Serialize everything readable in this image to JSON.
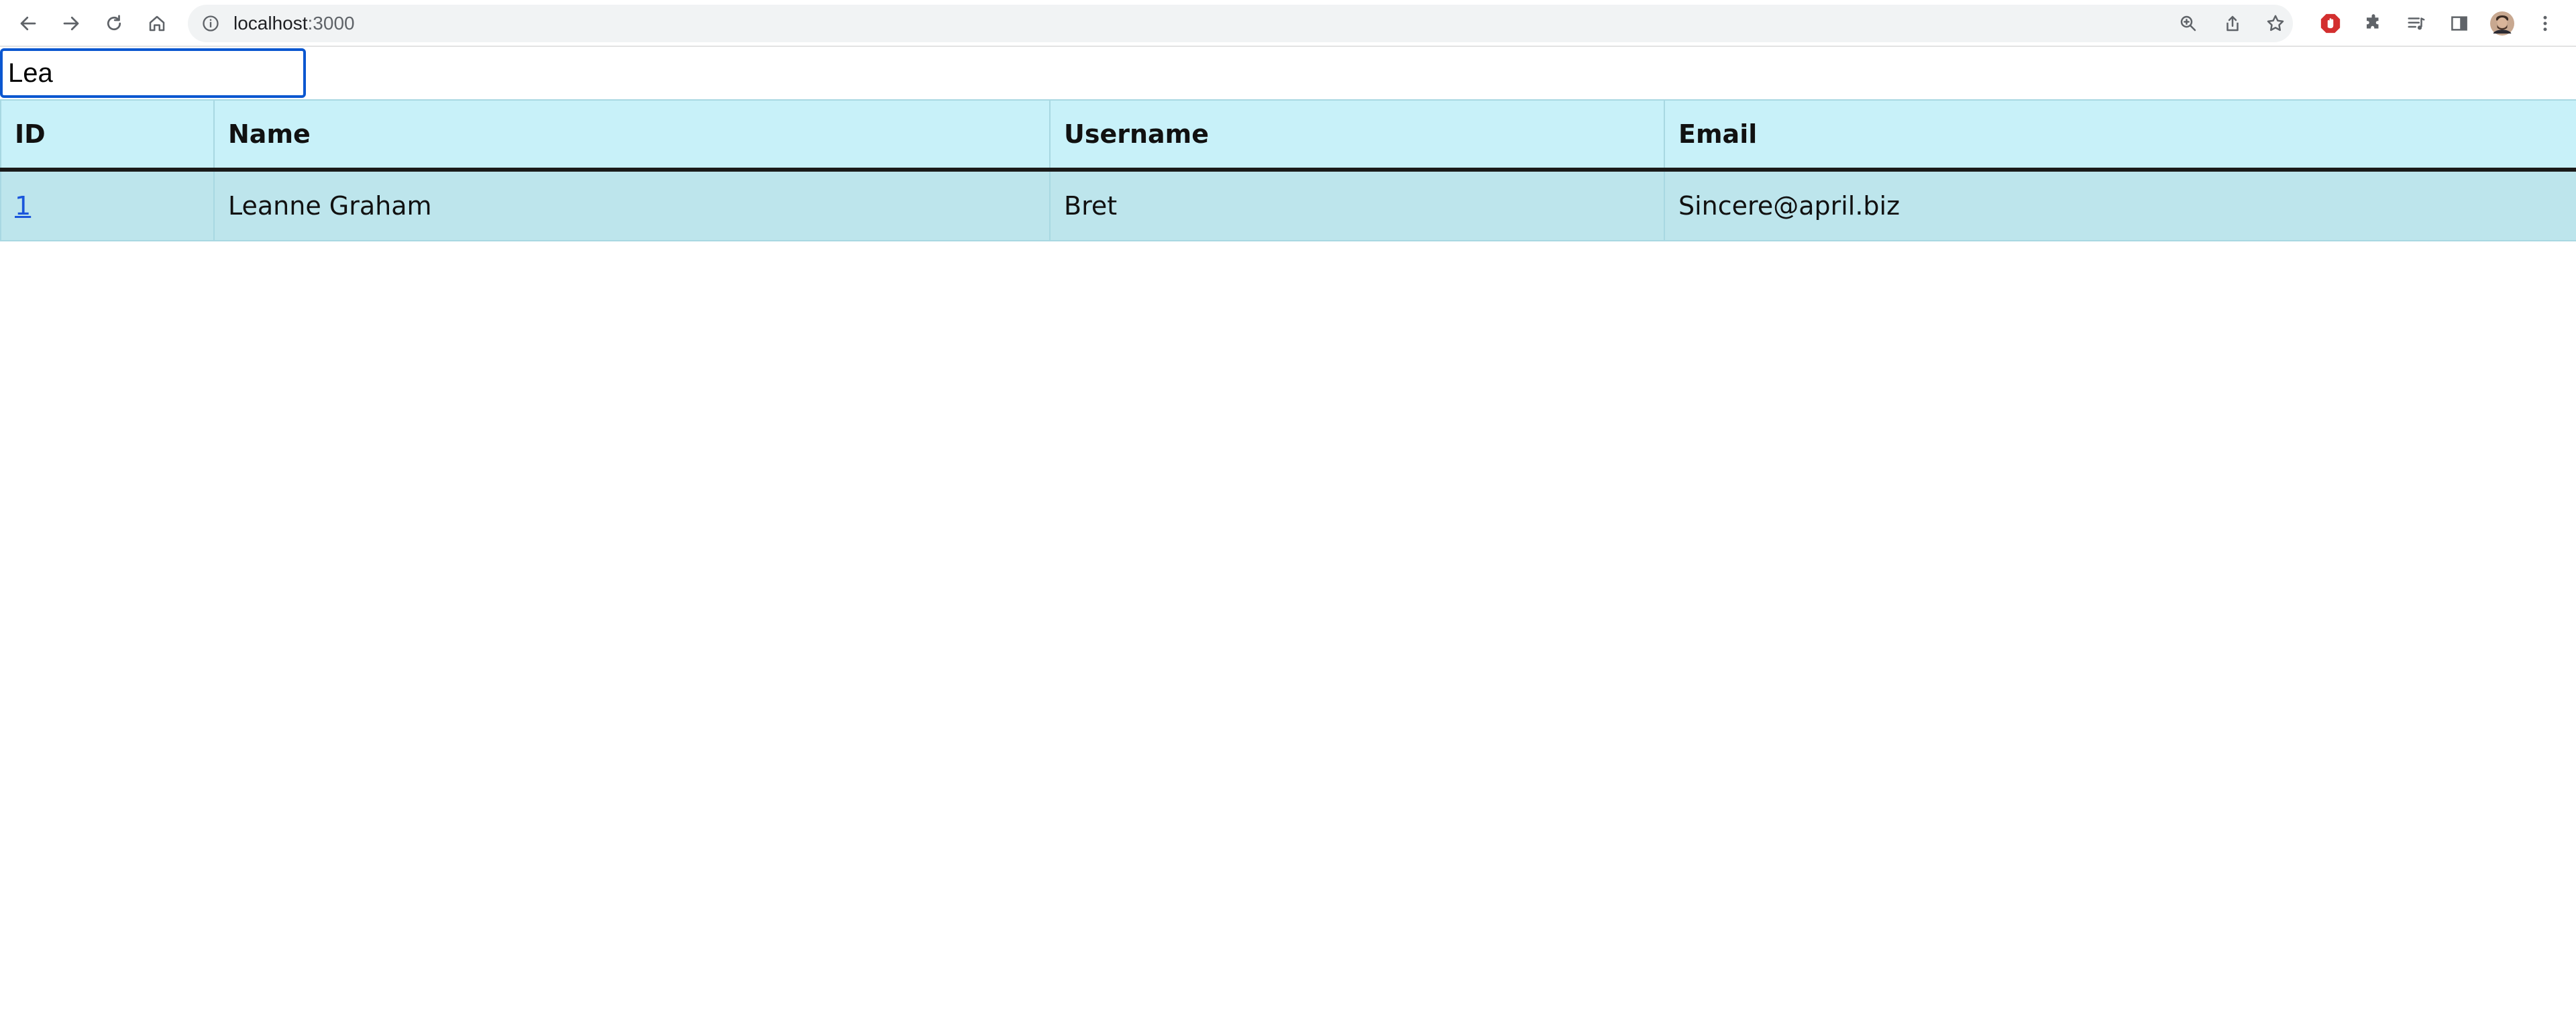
{
  "browser": {
    "url_host": "localhost",
    "url_port": ":3000",
    "icons": {
      "back": "back-arrow-icon",
      "forward": "forward-arrow-icon",
      "reload": "reload-icon",
      "home": "home-icon",
      "site_info": "info-icon",
      "zoom": "zoom-icon",
      "share": "share-icon",
      "bookmark": "star-icon",
      "adblock": "adblock-icon",
      "extensions": "puzzle-icon",
      "media": "media-queue-icon",
      "side_panel": "side-panel-icon",
      "profile": "avatar",
      "menu": "kebab-menu-icon"
    }
  },
  "search": {
    "value": "Lea"
  },
  "table": {
    "headers": [
      "ID",
      "Name",
      "Username",
      "Email"
    ],
    "rows": [
      {
        "id": "1",
        "name": "Leanne Graham",
        "username": "Bret",
        "email": "Sincere@april.biz"
      }
    ]
  },
  "colors": {
    "header_bg": "#c8f1f9",
    "row_bg": "#bde5ec",
    "link": "#1a56db",
    "focus_ring": "#0b57d0"
  }
}
